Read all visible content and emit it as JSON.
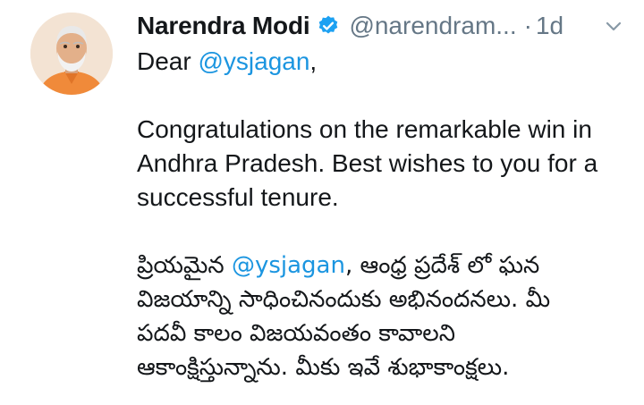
{
  "author": {
    "name": "Narendra Modi",
    "handle": "@narendram...",
    "separator": "·",
    "time": "1d",
    "verified": true,
    "avatar_icon": "profile-photo"
  },
  "tweet": {
    "greeting_prefix": "Dear",
    "greeting_mention": "@ysjagan",
    "greeting_suffix": ",",
    "english_line1": "Congratulations on the remarkable win in",
    "english_line2": "Andhra Pradesh. Best wishes to you for a",
    "english_line3": "successful tenure.",
    "telugu_prefix": "ప్రియమైన",
    "telugu_mention": "@ysjagan",
    "telugu_line1_rest": ", ఆంధ్ర ప్రదేశ్ లో  ఘన",
    "telugu_line2": "విజయాన్ని సాధించినందుకు  అభినందనలు. మీ",
    "telugu_line3": "పదవీ కాలం విజయవంతం కావాలని",
    "telugu_line4": "ఆకాంక్షిస్తున్నాను. మీకు ఇవే శుభాకాంక్షలు."
  },
  "colors": {
    "link": "#1b95e0",
    "verified_badge": "#1da1f2",
    "secondary_text": "#657786"
  }
}
